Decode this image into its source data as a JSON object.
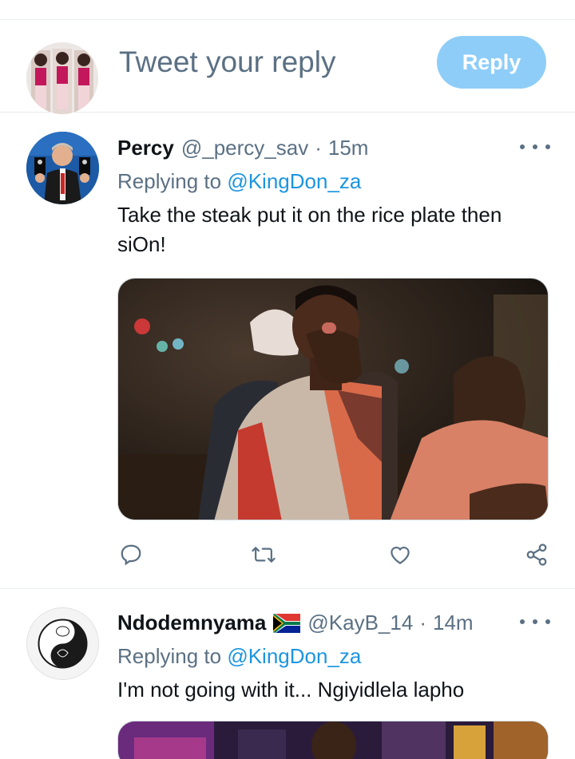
{
  "composer": {
    "placeholder": "Tweet your reply",
    "reply_label": "Reply"
  },
  "tweets": [
    {
      "name": "Percy",
      "handle": "@_percy_sav",
      "separator": "·",
      "time": "15m",
      "replying_prefix": "Replying to",
      "replying_to": "@KingDon_za",
      "text": "Take the steak put it on the rice plate then siOn!",
      "has_media": true
    },
    {
      "name": "Ndodemnyama",
      "flag": "south-africa-flag",
      "handle": "@KayB_14",
      "separator": "·",
      "time": "14m",
      "replying_prefix": "Replying to",
      "replying_to": "@KingDon_za",
      "text": "I'm not going with it... Ngiyidlela lapho",
      "has_media": true
    }
  ],
  "icons": {
    "reply": "reply-icon",
    "retweet": "retweet-icon",
    "like": "like-icon",
    "share": "share-icon",
    "more": "more-icon"
  },
  "colors": {
    "reply_button": "#8ecdf8",
    "mention": "#1b95e0",
    "secondary_text": "#5b7083"
  }
}
